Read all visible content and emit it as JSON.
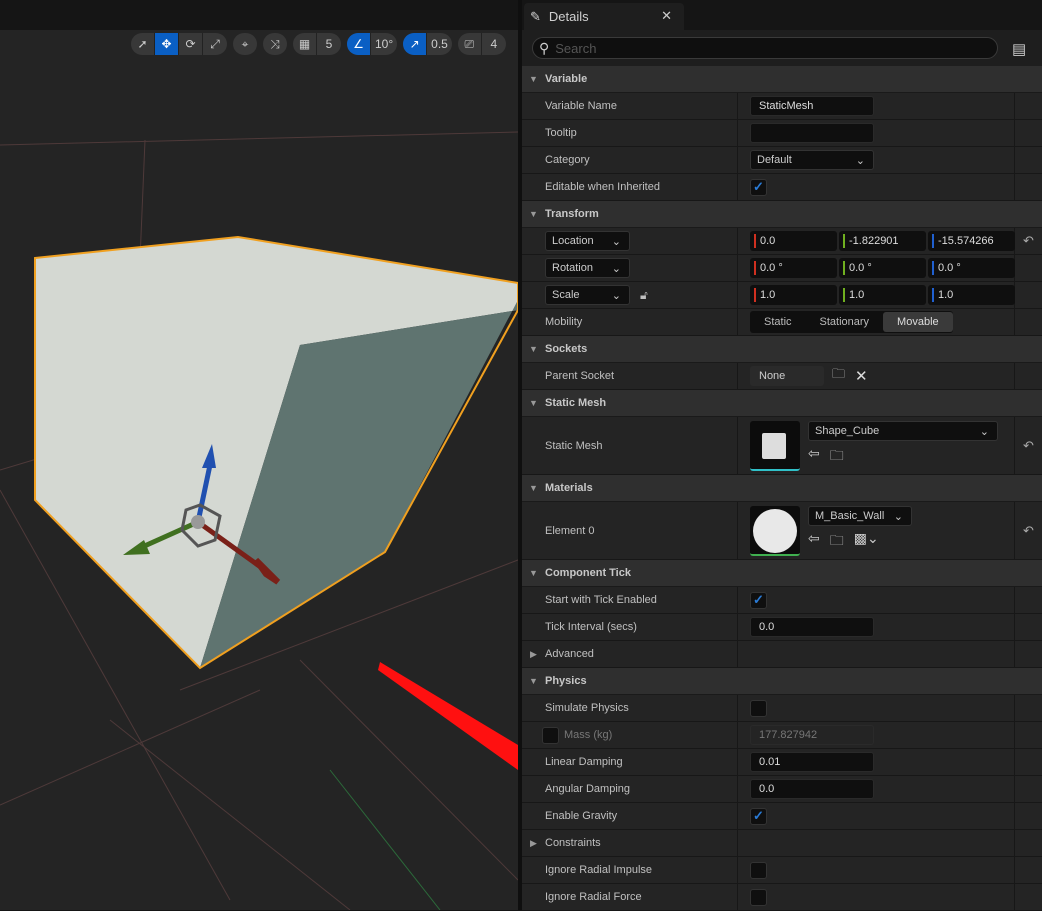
{
  "toolbar": {
    "select": "select-icon",
    "translate": "translate-icon",
    "rotate": "rotate-icon",
    "scale": "scale-icon",
    "grid_snap": "5",
    "rotation_snap": "10°",
    "scale_snap": "0.5",
    "camera_speed": "4"
  },
  "colors": {
    "accent": "#0a5fc4",
    "selection": "#f0a020",
    "x_axis": "#d03020",
    "y_axis": "#70b020",
    "z_axis": "#2060d0"
  },
  "panel": {
    "tab_title": "Details",
    "search_placeholder": "Search"
  },
  "variable": {
    "header": "Variable",
    "name_label": "Variable Name",
    "name_value": "StaticMesh",
    "tooltip_label": "Tooltip",
    "tooltip_value": "",
    "category_label": "Category",
    "category_value": "Default",
    "editable_label": "Editable when Inherited",
    "editable_checked": true
  },
  "transform": {
    "header": "Transform",
    "location": {
      "label": "Location",
      "x": "0.0",
      "y": "-1.822901",
      "z": "-15.574266"
    },
    "rotation": {
      "label": "Rotation",
      "x": "0.0 °",
      "y": "0.0 °",
      "z": "0.0 °"
    },
    "scale": {
      "label": "Scale",
      "x": "1.0",
      "y": "1.0",
      "z": "1.0"
    },
    "mobility_label": "Mobility",
    "mobility_options": [
      "Static",
      "Stationary",
      "Movable"
    ],
    "mobility_selected": "Movable"
  },
  "sockets": {
    "header": "Sockets",
    "parent_label": "Parent Socket",
    "parent_value": "None"
  },
  "static_mesh": {
    "header": "Static Mesh",
    "label": "Static Mesh",
    "value": "Shape_Cube"
  },
  "materials": {
    "header": "Materials",
    "label": "Element 0",
    "value": "M_Basic_Wall"
  },
  "component_tick": {
    "header": "Component Tick",
    "start_label": "Start with Tick Enabled",
    "start_checked": true,
    "interval_label": "Tick Interval (secs)",
    "interval_value": "0.0",
    "advanced_label": "Advanced"
  },
  "physics": {
    "header": "Physics",
    "simulate_label": "Simulate Physics",
    "simulate_checked": false,
    "mass_label": "Mass (kg)",
    "mass_value": "177.827942",
    "linear_label": "Linear Damping",
    "linear_value": "0.01",
    "angular_label": "Angular Damping",
    "angular_value": "0.0",
    "gravity_label": "Enable Gravity",
    "gravity_checked": true,
    "constraints_label": "Constraints",
    "impulse_label": "Ignore Radial Impulse",
    "impulse_checked": false,
    "force_label": "Ignore Radial Force",
    "force_checked": false
  }
}
